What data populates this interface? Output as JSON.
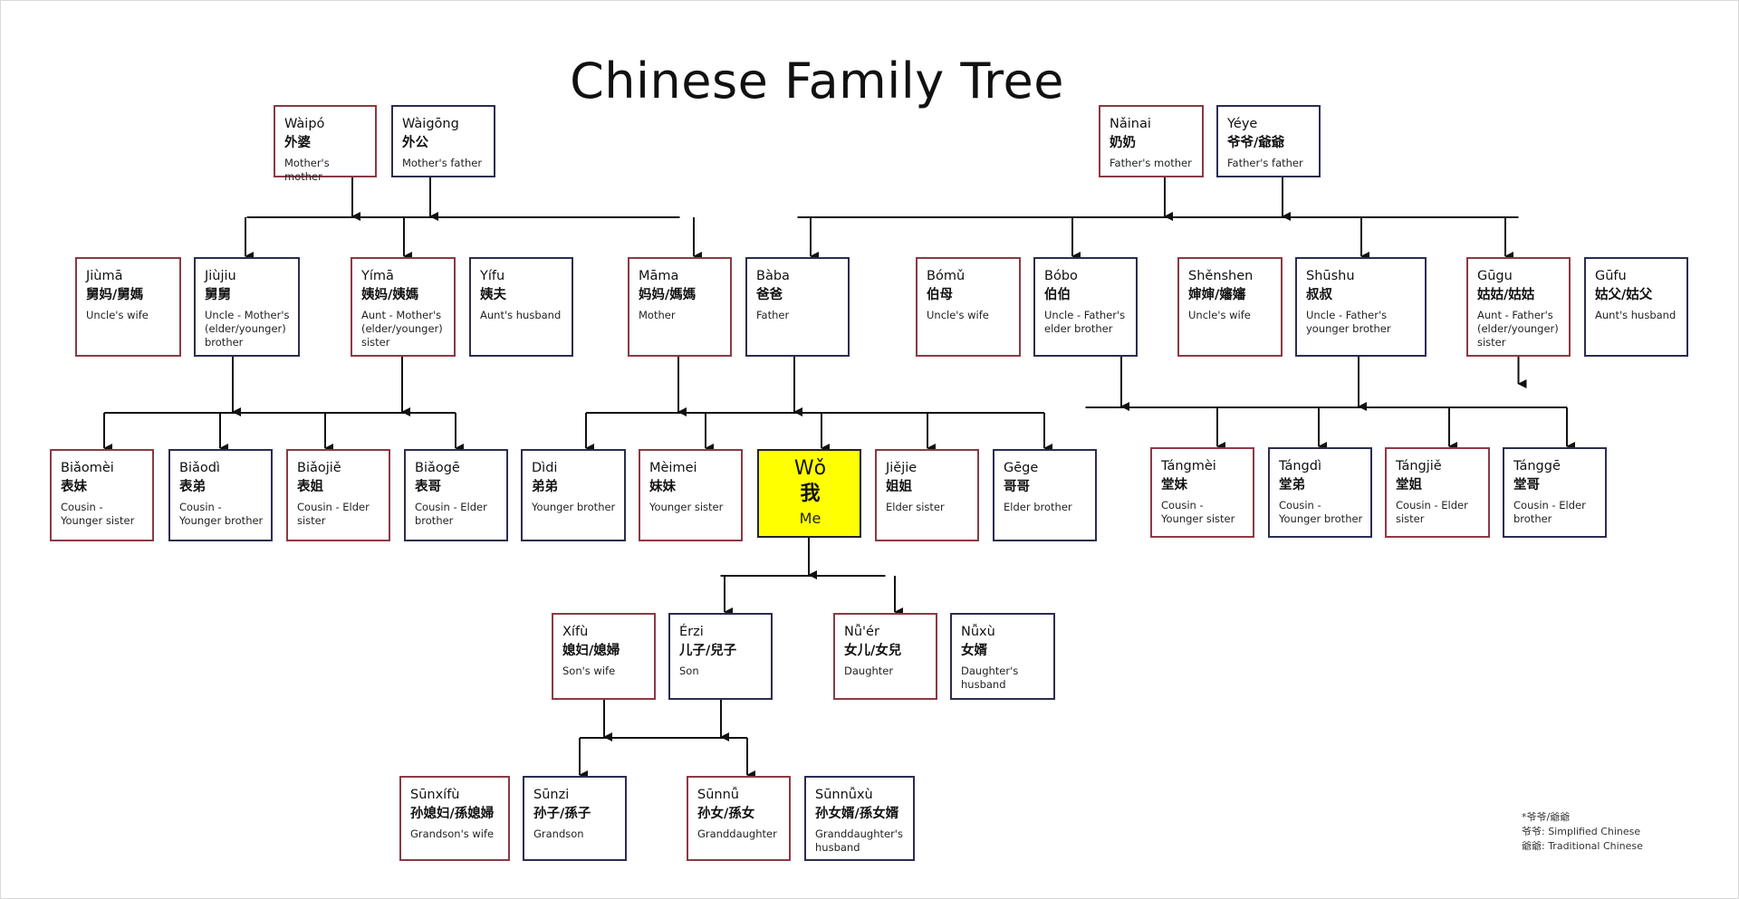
{
  "title": "Chinese Family Tree",
  "colors": {
    "male_border": "#2b2d4f",
    "female_border": "#8a3a44",
    "me_fill": "#ffff00",
    "line": "#111111"
  },
  "nodes": [
    {
      "id": "waipo",
      "pinyin": "Wàipó",
      "hanzi": "外婆",
      "english": "Mother's mother",
      "gender": "female"
    },
    {
      "id": "waigong",
      "pinyin": "Wàigōng",
      "hanzi": "外公",
      "english": "Mother's father",
      "gender": "male"
    },
    {
      "id": "nainai",
      "pinyin": "Nǎinai",
      "hanzi": "奶奶",
      "english": "Father's mother",
      "gender": "female"
    },
    {
      "id": "yeye",
      "pinyin": "Yéye",
      "hanzi": "爷爷/爺爺",
      "english": "Father's father",
      "gender": "male"
    },
    {
      "id": "jiuma",
      "pinyin": "Jiùmā",
      "hanzi": "舅妈/舅媽",
      "english": "Uncle's wife",
      "gender": "female"
    },
    {
      "id": "jiujiu",
      "pinyin": "Jiùjiu",
      "hanzi": "舅舅",
      "english": "Uncle - Mother's (elder/younger) brother",
      "gender": "male"
    },
    {
      "id": "yima",
      "pinyin": "Yímā",
      "hanzi": "姨妈/姨媽",
      "english": "Aunt - Mother's (elder/younger) sister",
      "gender": "female"
    },
    {
      "id": "yifu",
      "pinyin": "Yífu",
      "hanzi": "姨夫",
      "english": "Aunt's husband",
      "gender": "male"
    },
    {
      "id": "mama",
      "pinyin": "Māma",
      "hanzi": "妈妈/媽媽",
      "english": "Mother",
      "gender": "female"
    },
    {
      "id": "baba",
      "pinyin": "Bàba",
      "hanzi": "爸爸",
      "english": "Father",
      "gender": "male"
    },
    {
      "id": "bomu",
      "pinyin": "Bómǔ",
      "hanzi": "伯母",
      "english": "Uncle's wife",
      "gender": "female"
    },
    {
      "id": "bobo",
      "pinyin": "Bóbo",
      "hanzi": "伯伯",
      "english": "Uncle - Father's elder brother",
      "gender": "male"
    },
    {
      "id": "shenshen",
      "pinyin": "Shěnshen",
      "hanzi": "婶婶/嬸嬸",
      "english": "Uncle's wife",
      "gender": "female"
    },
    {
      "id": "shushu",
      "pinyin": "Shūshu",
      "hanzi": "叔叔",
      "english": "Uncle - Father's younger brother",
      "gender": "male"
    },
    {
      "id": "gugu",
      "pinyin": "Gūgu",
      "hanzi": "姑姑/姑姑",
      "english": "Aunt - Father's (elder/younger) sister",
      "gender": "female"
    },
    {
      "id": "gufu",
      "pinyin": "Gūfu",
      "hanzi": "姑父/姑父",
      "english": "Aunt's husband",
      "gender": "male"
    },
    {
      "id": "biaomei",
      "pinyin": "Biǎomèi",
      "hanzi": "表妹",
      "english": "Cousin - Younger sister",
      "gender": "female"
    },
    {
      "id": "biaodi",
      "pinyin": "Biǎodì",
      "hanzi": "表弟",
      "english": "Cousin - Younger brother",
      "gender": "male"
    },
    {
      "id": "biaojie",
      "pinyin": "Biǎojiě",
      "hanzi": "表姐",
      "english": "Cousin - Elder sister",
      "gender": "female"
    },
    {
      "id": "biaoge",
      "pinyin": "Biǎogē",
      "hanzi": "表哥",
      "english": "Cousin - Elder brother",
      "gender": "male"
    },
    {
      "id": "didi",
      "pinyin": "Dìdi",
      "hanzi": "弟弟",
      "english": "Younger brother",
      "gender": "male"
    },
    {
      "id": "meimei",
      "pinyin": "Mèimei",
      "hanzi": "妹妹",
      "english": "Younger sister",
      "gender": "female"
    },
    {
      "id": "wo",
      "pinyin": "Wǒ",
      "hanzi": "我",
      "english": "Me",
      "gender": "me"
    },
    {
      "id": "jiejie",
      "pinyin": "Jiějie",
      "hanzi": "姐姐",
      "english": "Elder sister",
      "gender": "female"
    },
    {
      "id": "gege",
      "pinyin": "Gēge",
      "hanzi": "哥哥",
      "english": "Elder brother",
      "gender": "male"
    },
    {
      "id": "tangmei",
      "pinyin": "Tángmèi",
      "hanzi": "堂妹",
      "english": "Cousin - Younger sister",
      "gender": "female"
    },
    {
      "id": "tangdi",
      "pinyin": "Tángdì",
      "hanzi": "堂弟",
      "english": "Cousin - Younger brother",
      "gender": "male"
    },
    {
      "id": "tangjie",
      "pinyin": "Tángjiě",
      "hanzi": "堂姐",
      "english": "Cousin - Elder sister",
      "gender": "female"
    },
    {
      "id": "tangge",
      "pinyin": "Tánggē",
      "hanzi": "堂哥",
      "english": "Cousin - Elder brother",
      "gender": "male"
    },
    {
      "id": "xifu",
      "pinyin": "Xífù",
      "hanzi": "媳妇/媳婦",
      "english": "Son's wife",
      "gender": "female"
    },
    {
      "id": "erzi",
      "pinyin": "Érzi",
      "hanzi": "儿子/兒子",
      "english": "Son",
      "gender": "male"
    },
    {
      "id": "nuer",
      "pinyin": "Nǚ'ér",
      "hanzi": "女儿/女兒",
      "english": "Daughter",
      "gender": "female"
    },
    {
      "id": "nuxu",
      "pinyin": "Nǚxù",
      "hanzi": "女婿",
      "english": "Daughter's husband",
      "gender": "male"
    },
    {
      "id": "sunxifu",
      "pinyin": "Sūnxífù",
      "hanzi": "孙媳妇/孫媳婦",
      "english": "Grandson's wife",
      "gender": "female"
    },
    {
      "id": "sunzi",
      "pinyin": "Sūnzi",
      "hanzi": "孙子/孫子",
      "english": "Grandson",
      "gender": "male"
    },
    {
      "id": "sunnu",
      "pinyin": "Sūnnǚ",
      "hanzi": "孙女/孫女",
      "english": "Granddaughter",
      "gender": "female"
    },
    {
      "id": "sunnuxu",
      "pinyin": "Sūnnǚxù",
      "hanzi": "孙女婿/孫女婿",
      "english": "Granddaughter's husband",
      "gender": "male"
    }
  ],
  "edges": [
    {
      "from": [
        "waipo",
        "waigong"
      ],
      "to": [
        "jiujiu",
        "yima",
        "mama"
      ]
    },
    {
      "from": [
        "nainai",
        "yeye"
      ],
      "to": [
        "baba",
        "bobo",
        "shushu",
        "gugu"
      ]
    },
    {
      "from": [
        "jiujiu",
        "yima"
      ],
      "to": [
        "biaomei",
        "biaodi",
        "biaojie",
        "biaoge"
      ]
    },
    {
      "from": [
        "mama",
        "baba"
      ],
      "to": [
        "didi",
        "meimei",
        "wo",
        "jiejie",
        "gege"
      ]
    },
    {
      "from": [
        "bobo",
        "shushu"
      ],
      "to": [
        "tangmei",
        "tangdi",
        "tangjie",
        "tangge"
      ]
    },
    {
      "from": [
        "gugu"
      ],
      "to": []
    },
    {
      "from": [
        "wo"
      ],
      "to": [
        "erzi",
        "nuer"
      ]
    },
    {
      "from": [
        "xifu",
        "erzi"
      ],
      "to": [
        "sunzi",
        "sunnu"
      ]
    }
  ],
  "legend": {
    "heading": "*爷爷/爺爺",
    "simplified": "爷爷: Simplified Chinese",
    "traditional": "爺爺: Traditional Chinese"
  }
}
